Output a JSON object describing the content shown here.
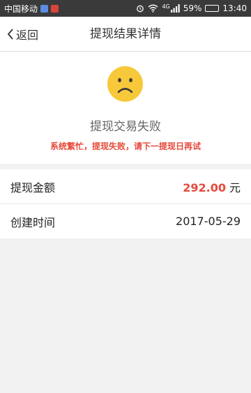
{
  "status_bar": {
    "carrier": "中国移动",
    "network": "4G",
    "battery": "59%",
    "battery_level": 0.59,
    "time": "13:40"
  },
  "nav": {
    "back_label": "返回",
    "title": "提现结果详情"
  },
  "result": {
    "title": "提现交易失败",
    "message": "系统繁忙，提现失败，请下一提现日再试"
  },
  "details": {
    "amount_label": "提现金额",
    "amount_value": "292.00",
    "amount_unit": "元",
    "created_label": "创建时间",
    "created_value": "2017-05-29"
  },
  "colors": {
    "accent_red": "#e64a3b",
    "face_yellow": "#f7c83a"
  }
}
